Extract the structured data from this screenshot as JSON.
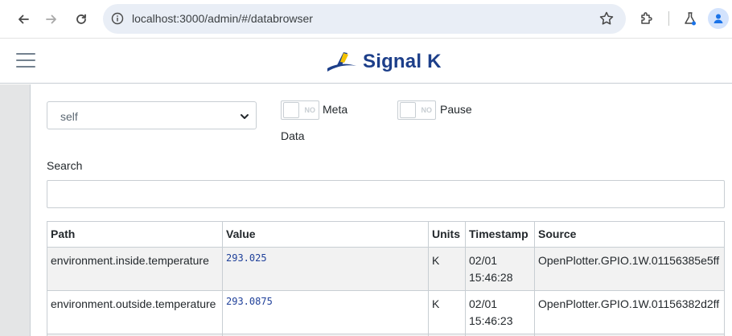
{
  "browser": {
    "url": "localhost:3000/admin/#/databrowser"
  },
  "header": {
    "logo_text": "Signal K"
  },
  "controls": {
    "context_select": "self",
    "meta_switch_state": "NO",
    "meta_label_line1": "Meta",
    "meta_label_line2": "Data",
    "pause_switch_state": "NO",
    "pause_label": "Pause",
    "search_label": "Search",
    "search_value": ""
  },
  "table": {
    "headers": [
      "Path",
      "Value",
      "Units",
      "Timestamp",
      "Source"
    ],
    "rows": [
      {
        "path": "environment.inside.temperature",
        "value": "293.025",
        "units": "K",
        "date": "02/01",
        "time": "15:46:28",
        "source": "OpenPlotter.GPIO.1W.01156385e5ff"
      },
      {
        "path": "environment.outside.temperature",
        "value": "293.0875",
        "units": "K",
        "date": "02/01",
        "time": "15:46:23",
        "source": "OpenPlotter.GPIO.1W.01156382d2ff"
      }
    ]
  },
  "colors": {
    "brand_blue": "#1d3f8a",
    "value_blue": "#20419a",
    "omnibox_bg": "#e9eef6"
  }
}
